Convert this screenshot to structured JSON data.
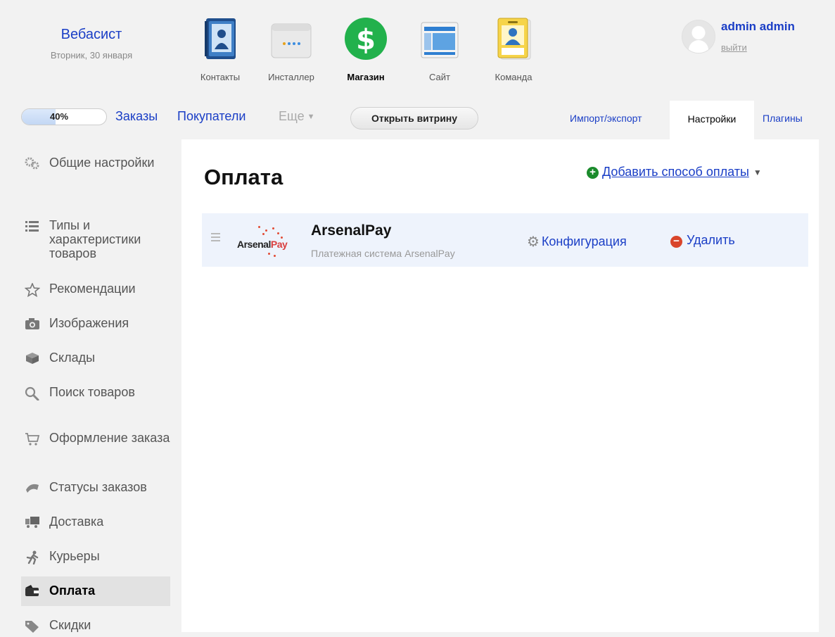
{
  "brand": {
    "name": "Вебасист",
    "date": "Вторник, 30 января"
  },
  "apps": [
    {
      "label": "Контакты",
      "icon": "contacts-book-icon",
      "active": false
    },
    {
      "label": "Инсталлер",
      "icon": "installer-box-icon",
      "active": false
    },
    {
      "label": "Магазин",
      "icon": "shop-dollar-icon",
      "active": true
    },
    {
      "label": "Сайт",
      "icon": "site-browser-icon",
      "active": false
    },
    {
      "label": "Команда",
      "icon": "team-badge-icon",
      "active": false
    }
  ],
  "user": {
    "name": "admin admin",
    "logout": "выйти"
  },
  "subnav": {
    "progress": {
      "text": "40%",
      "value": 0.4
    },
    "orders": "Заказы",
    "customers": "Покупатели",
    "more": "Еще",
    "open_storefront": "Открыть витрину",
    "import_export": "Импорт/экспорт",
    "settings": "Настройки",
    "plugins": "Плагины"
  },
  "sidebar": {
    "items": [
      {
        "label": "Общие настройки",
        "icon": "gears-icon"
      },
      {
        "label": "Типы и характеристики товаров",
        "icon": "list-icon"
      },
      {
        "label": "Рекомендации",
        "icon": "star-icon"
      },
      {
        "label": "Изображения",
        "icon": "camera-icon"
      },
      {
        "label": "Склады",
        "icon": "box-icon"
      },
      {
        "label": "Поиск товаров",
        "icon": "search-icon"
      },
      {
        "label": "Оформление заказа",
        "icon": "cart-icon"
      },
      {
        "label": "Статусы заказов",
        "icon": "flag-icon"
      },
      {
        "label": "Доставка",
        "icon": "truck-icon"
      },
      {
        "label": "Курьеры",
        "icon": "runner-icon"
      },
      {
        "label": "Оплата",
        "icon": "wallet-icon",
        "selected": true
      },
      {
        "label": "Скидки",
        "icon": "tag-icon"
      }
    ]
  },
  "main": {
    "title": "Оплата",
    "add_method": "Добавить способ оплаты",
    "plugins": [
      {
        "name": "ArsenalPay",
        "description": "Платежная система ArsenalPay",
        "logo_text_a": "Arsenal",
        "logo_text_b": "Pay",
        "configure": "Конфигурация",
        "delete": "Удалить"
      }
    ]
  },
  "colors": {
    "link": "#1a3ec6",
    "add_green": "#1b8b2c",
    "delete_red": "#d9452b",
    "row_bg": "#eef3fc"
  }
}
